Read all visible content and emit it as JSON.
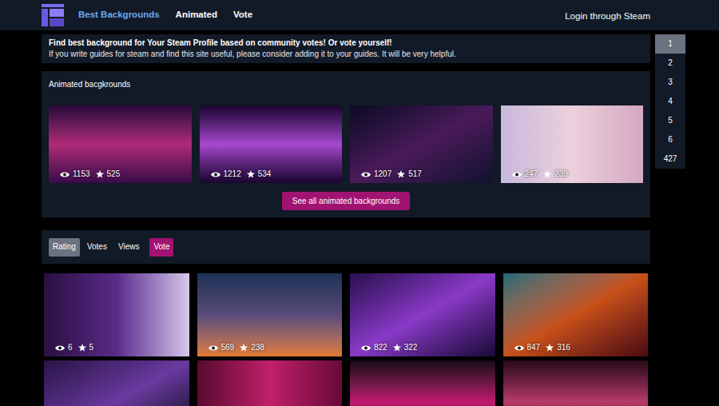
{
  "nav": {
    "links": [
      {
        "label": "Best Backgrounds",
        "selected": true
      },
      {
        "label": "Animated",
        "selected": false
      },
      {
        "label": "Vote",
        "selected": false
      }
    ],
    "login": "Login through Steam"
  },
  "notice": {
    "title": "Find best background for Your Steam Profile based on community votes! Or vote yourself!",
    "text": "If you write guides for steam and find this site useful, please consider adding it to your guides. It will be very helpful."
  },
  "animated": {
    "title": "Animated bacgkrounds",
    "items": [
      {
        "views": "1153",
        "votes": "525"
      },
      {
        "views": "1212",
        "votes": "534"
      },
      {
        "views": "1207",
        "votes": "517"
      },
      {
        "views": "247",
        "votes": "239"
      }
    ],
    "button": "See all animated backgrounds"
  },
  "sort_tabs": [
    {
      "label": "Rating",
      "selected": true,
      "kind": "tab"
    },
    {
      "label": "Votes",
      "selected": false,
      "kind": "tab"
    },
    {
      "label": "Views",
      "selected": false,
      "kind": "tab"
    },
    {
      "label": "Vote",
      "selected": false,
      "kind": "action"
    }
  ],
  "backgrounds": [
    {
      "kind": "full",
      "views": "6",
      "votes": "5"
    },
    {
      "kind": "full",
      "views": "569",
      "votes": "238"
    },
    {
      "kind": "full",
      "views": "822",
      "votes": "322"
    },
    {
      "kind": "full",
      "views": "847",
      "votes": "316"
    },
    {
      "kind": "partial"
    },
    {
      "kind": "partial"
    },
    {
      "kind": "partial"
    },
    {
      "kind": "partial"
    }
  ],
  "pagination": [
    {
      "label": "1",
      "selected": true
    },
    {
      "label": "2",
      "selected": false
    },
    {
      "label": "3",
      "selected": false
    },
    {
      "label": "4",
      "selected": false
    },
    {
      "label": "5",
      "selected": false
    },
    {
      "label": "6",
      "selected": false
    },
    {
      "label": "427",
      "selected": false
    }
  ]
}
